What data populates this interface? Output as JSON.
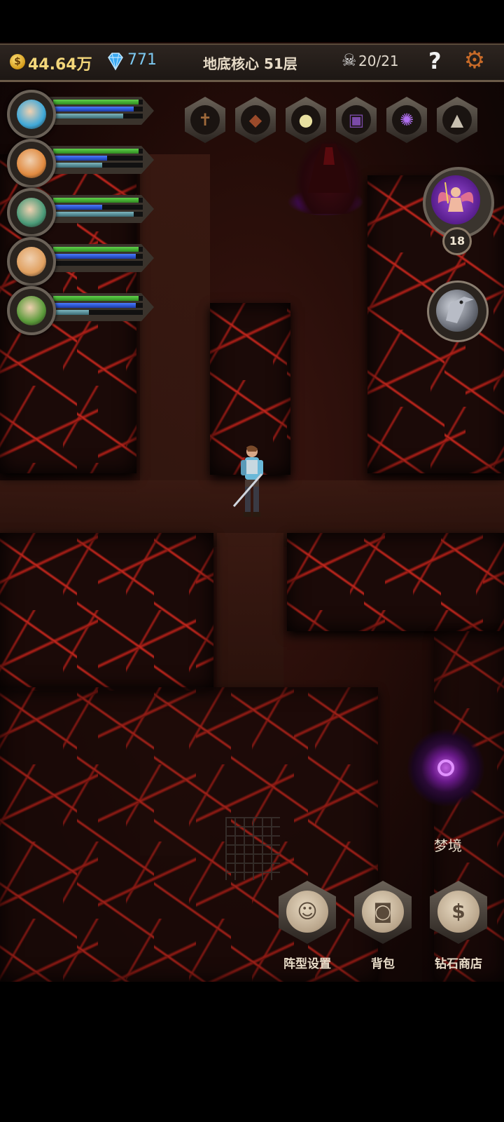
{
  "hud": {
    "gold_amount": "44.64万",
    "gem_amount": "771",
    "floor_name": "地底核心 51层",
    "kills": "20/21",
    "help_symbol": "?",
    "coin_symbol": "$",
    "gold_color": "#f3d67a",
    "gem_color": "#7cc8f0"
  },
  "party": [
    {
      "name": "hero-1",
      "hp": 0.95,
      "mp": 0.9,
      "xp": 0.78,
      "color": "#3fa8d8"
    },
    {
      "name": "hero-2",
      "hp": 0.95,
      "mp": 0.6,
      "xp": 0.55,
      "color": "#e08a40"
    },
    {
      "name": "hero-3",
      "hp": 0.95,
      "mp": 0.55,
      "xp": 0.9,
      "color": "#4a9a78"
    },
    {
      "name": "hero-4",
      "hp": 0.95,
      "mp": 0.92,
      "xp": 0.0,
      "color": "#e0a060"
    },
    {
      "name": "hero-5",
      "hp": 0.95,
      "mp": 0.92,
      "xp": 0.4,
      "color": "#5a9a3a"
    }
  ],
  "skills": [
    {
      "name": "coffin-skill-icon",
      "glyph": "✝"
    },
    {
      "name": "scale-armor-skill-icon",
      "glyph": "◆"
    },
    {
      "name": "bread-skill-icon",
      "glyph": "●"
    },
    {
      "name": "spellbook-skill-icon",
      "glyph": "▣"
    },
    {
      "name": "void-vortex-skill-icon",
      "glyph": "✺"
    },
    {
      "name": "eagle-skill-icon",
      "glyph": "▲"
    }
  ],
  "boss": {
    "level": "18"
  },
  "portal": {
    "label": "梦境"
  },
  "menu": {
    "formation_label": "阵型设置",
    "bag_label": "背包",
    "shop_label": "钻石商店",
    "formation_glyph": "☺",
    "bag_glyph": "◙",
    "shop_glyph": "$"
  }
}
